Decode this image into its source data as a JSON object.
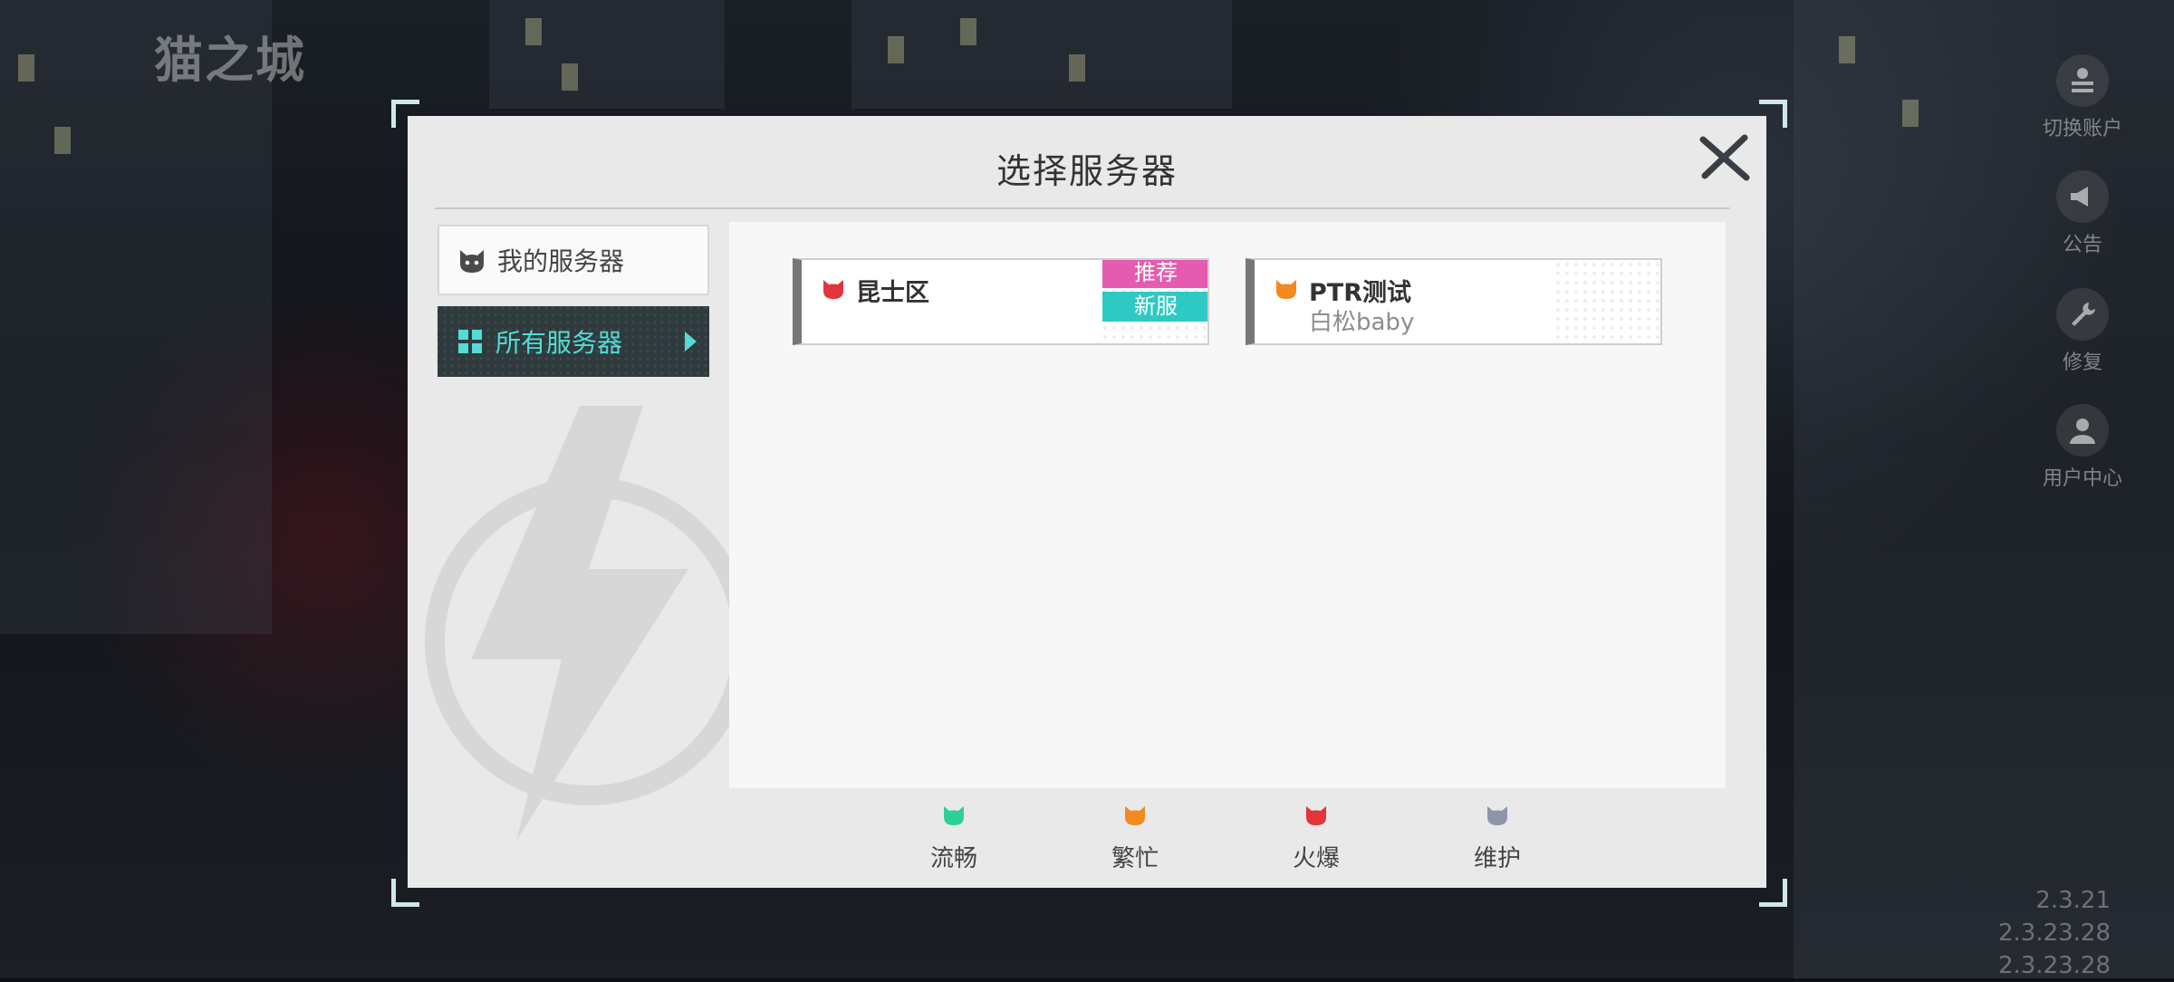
{
  "logo_text": "猫之城",
  "side_menu": [
    {
      "label": "切换账户",
      "icon": "switch-account-icon"
    },
    {
      "label": "公告",
      "icon": "megaphone-icon"
    },
    {
      "label": "修复",
      "icon": "wrench-icon"
    },
    {
      "label": "用户中心",
      "icon": "user-icon"
    }
  ],
  "versions": [
    "2.3.21",
    "2.3.23.28",
    "2.3.23.28"
  ],
  "dialog": {
    "title": "选择服务器",
    "tabs": [
      {
        "label": "我的服务器",
        "icon": "cat-icon",
        "selected": false
      },
      {
        "label": "所有服务器",
        "icon": "grid-icon",
        "selected": true
      }
    ],
    "servers": [
      {
        "name": "昆士区",
        "owner": "",
        "status_color": "#e2343b",
        "badges": [
          "推荐",
          "新服"
        ]
      },
      {
        "name": "PTR测试",
        "owner": "白松baby",
        "status_color": "#f28a1e",
        "badges": []
      }
    ],
    "legend": [
      {
        "label": "流畅",
        "color": "#2fcf95"
      },
      {
        "label": "繁忙",
        "color": "#f28a1e"
      },
      {
        "label": "火爆",
        "color": "#e2343b"
      },
      {
        "label": "维护",
        "color": "#8c96aa"
      }
    ]
  }
}
